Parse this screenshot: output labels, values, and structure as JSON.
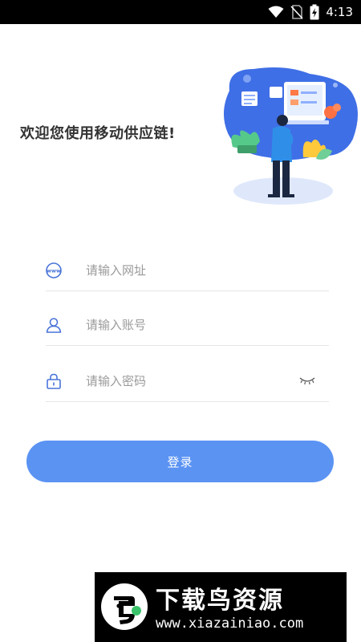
{
  "status_bar": {
    "time": "4:13"
  },
  "welcome_text": "欢迎您使用移动供应链!",
  "form": {
    "url_placeholder": "请输入网址",
    "account_placeholder": "请输入账号",
    "password_placeholder": "请输入密码",
    "login_label": "登录"
  },
  "icons": {
    "url": "www-icon",
    "account": "user-icon",
    "password": "lock-icon",
    "toggle_password": "eye-closed-icon"
  },
  "colors": {
    "accent": "#5b93f3",
    "icon": "#4a74d8",
    "hero_blob": "#3f6fe6"
  },
  "watermark": {
    "title": "下载鸟资源",
    "url": "www.xiazainiao.com"
  }
}
